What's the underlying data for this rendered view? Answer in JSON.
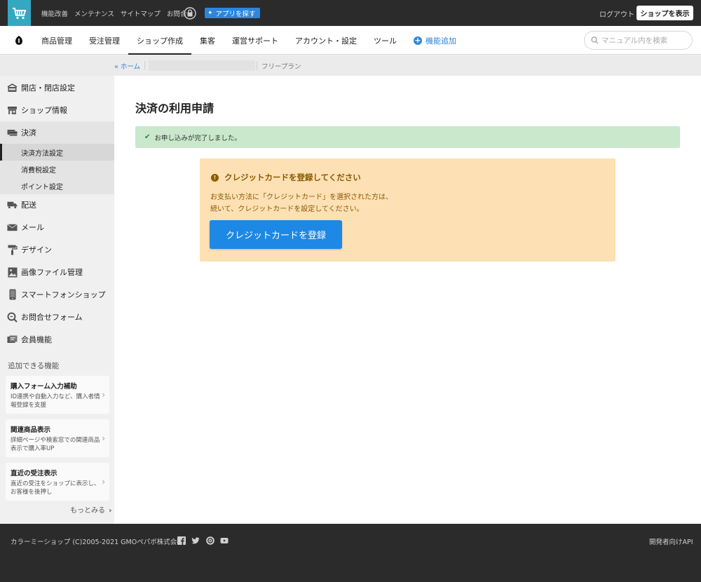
{
  "topbar": {
    "links": [
      "機能改善",
      "メンテナンス",
      "サイトマップ",
      "お問合せ"
    ],
    "app_button": "アプリを探す",
    "logout": "ログアウト",
    "shop_view": "ショップを表示"
  },
  "mainnav": {
    "items": [
      "商品管理",
      "受注管理",
      "ショップ作成",
      "集客",
      "運営サポート",
      "アカウント・設定",
      "ツール"
    ],
    "active": "ショップ作成",
    "add_feature": "機能追加",
    "search_placeholder": "マニュアル内を検索"
  },
  "breadcrumb": {
    "home": "« ホーム",
    "plan": "フリープラン"
  },
  "sidebar": {
    "items": [
      {
        "label": "開店・閉店設定",
        "icon": "shop-sign-icon"
      },
      {
        "label": "ショップ情報",
        "icon": "storefront-icon"
      },
      {
        "label": "決済",
        "icon": "payment-card-icon"
      },
      {
        "label": "配送",
        "icon": "truck-icon"
      },
      {
        "label": "メール",
        "icon": "envelope-icon"
      },
      {
        "label": "デザイン",
        "icon": "paint-roller-icon"
      },
      {
        "label": "画像ファイル管理",
        "icon": "image-icon"
      },
      {
        "label": "スマートフォンショップ",
        "icon": "smartphone-icon"
      },
      {
        "label": "お問合せフォーム",
        "icon": "search-chat-icon"
      },
      {
        "label": "会員機能",
        "icon": "member-card-icon"
      }
    ],
    "payment_subitems": [
      "決済方法設定",
      "消費税設定",
      "ポイント設定"
    ],
    "section_title": "追加できる機能",
    "features": [
      {
        "title": "購入フォーム入力補助",
        "desc": "ID連携や自動入力など、購入者情報登録を支援"
      },
      {
        "title": "関連商品表示",
        "desc": "詳細ページや検索窓での関連商品表示で購入率UP"
      },
      {
        "title": "直近の受注表示",
        "desc": "直近の受注をショップに表示し、お客様を後押し"
      }
    ],
    "more": "もっとみる"
  },
  "content": {
    "title": "決済の利用申請",
    "success_message": "お申し込みが完了しました。",
    "notice": {
      "title": "クレジットカードを登録してください",
      "line1": "お支払い方法に「クレジットカード」を選択された方は、",
      "line2": "続いて、クレジットカードを設定してください。",
      "button": "クレジットカードを登録"
    }
  },
  "footer": {
    "copyright": "カラーミーショップ (C)2005-2021 GMOペパボ株式会社",
    "dev_api": "開発者向けAPI"
  },
  "colors": {
    "accent_blue": "#1e88e5",
    "cart_logo_bg": "#34a7c1",
    "success_bg": "#c9e8cc",
    "notice_bg": "#fde0b4",
    "notice_text": "#8b5a00"
  }
}
